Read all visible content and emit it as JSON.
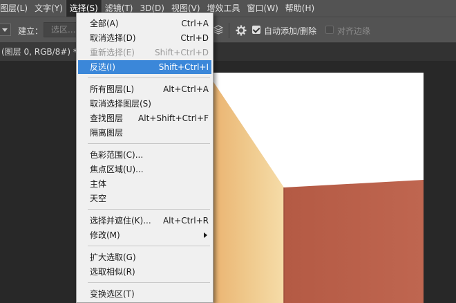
{
  "menubar": {
    "items": [
      {
        "label": "图层(L)"
      },
      {
        "label": "文字(Y)"
      },
      {
        "label": "选择(S)",
        "active": true
      },
      {
        "label": "滤镜(T)"
      },
      {
        "label": "3D(D)"
      },
      {
        "label": "视图(V)"
      },
      {
        "label": "增效工具"
      },
      {
        "label": "窗口(W)"
      },
      {
        "label": "帮助(H)"
      }
    ]
  },
  "options": {
    "create_label": "建立：",
    "selection_field": "选区...",
    "auto_add_delete_label": "自动添加/删除",
    "auto_add_delete_checked": true,
    "align_edges_label": "对齐边缘",
    "align_edges_checked": false
  },
  "document": {
    "tab_title": "(图层 0, RGB/8#) *"
  },
  "select_menu": {
    "items": [
      {
        "label": "全部(A)",
        "shortcut": "Ctrl+A",
        "state": "normal"
      },
      {
        "label": "取消选择(D)",
        "shortcut": "Ctrl+D",
        "state": "normal"
      },
      {
        "label": "重新选择(E)",
        "shortcut": "Shift+Ctrl+D",
        "state": "disabled"
      },
      {
        "label": "反选(I)",
        "shortcut": "Shift+Ctrl+I",
        "state": "highlighted"
      },
      {
        "label": "所有图层(L)",
        "shortcut": "Alt+Ctrl+A",
        "state": "normal"
      },
      {
        "label": "取消选择图层(S)",
        "shortcut": "",
        "state": "normal"
      },
      {
        "label": "查找图层",
        "shortcut": "Alt+Shift+Ctrl+F",
        "state": "normal"
      },
      {
        "label": "隔离图层",
        "shortcut": "",
        "state": "normal"
      },
      {
        "label": "色彩范围(C)...",
        "shortcut": "",
        "state": "normal"
      },
      {
        "label": "焦点区域(U)...",
        "shortcut": "",
        "state": "normal"
      },
      {
        "label": "主体",
        "shortcut": "",
        "state": "normal"
      },
      {
        "label": "天空",
        "shortcut": "",
        "state": "normal"
      },
      {
        "label": "选择并遮住(K)...",
        "shortcut": "Alt+Ctrl+R",
        "state": "normal"
      },
      {
        "label": "修改(M)",
        "shortcut": "",
        "state": "normal",
        "submenu": true
      },
      {
        "label": "扩大选取(G)",
        "shortcut": "",
        "state": "normal"
      },
      {
        "label": "选取相似(R)",
        "shortcut": "",
        "state": "normal"
      },
      {
        "label": "变换选区(T)",
        "shortcut": "",
        "state": "normal"
      }
    ]
  },
  "icons": {
    "dropdown": "chevron-down-icon",
    "stack": "layers-sample-icon",
    "settings": "gear-icon",
    "submenu": "chevron-right-icon"
  },
  "colors": {
    "menu_highlight": "#3b87d9",
    "chrome": "#535353",
    "canvas_bg": "#282828",
    "wall_left": "#e8b26e",
    "wall_right": "#b85e48",
    "sky": "#ffffff"
  }
}
